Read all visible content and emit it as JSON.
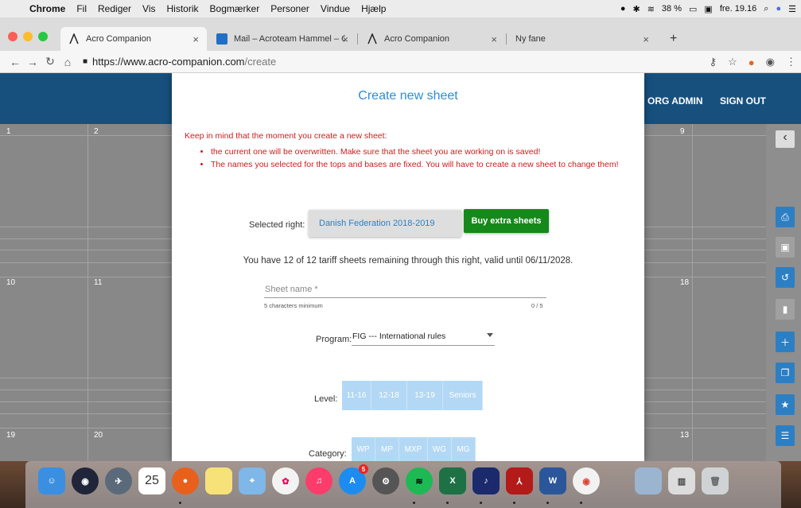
{
  "menubar": {
    "app": "Chrome",
    "items": [
      "Fil",
      "Rediger",
      "Vis",
      "Historik",
      "Bogmærker",
      "Personer",
      "Vindue",
      "Hjælp"
    ],
    "battery": "38 %",
    "clock": "fre. 19.16"
  },
  "tabs": [
    {
      "label": "Acro Companion"
    },
    {
      "label": "Mail – Acroteam Hammel – Out"
    },
    {
      "label": "Acro Companion"
    },
    {
      "label": "Ny fane"
    }
  ],
  "address": {
    "host": "https://www.acro-companion.com",
    "path": "/create"
  },
  "header": {
    "org_admin": "ORG ADMIN",
    "sign_out": "SIGN OUT"
  },
  "grid_numbers": [
    "1",
    "2",
    "9",
    "10",
    "11",
    "18",
    "19",
    "20",
    "13"
  ],
  "modal": {
    "title": "Create new sheet",
    "warning_intro": "Keep in mind that the moment you create a new sheet:",
    "warning_items": [
      "the current one will be overwritten. Make sure that the sheet you are working on is saved!",
      "The names you selected for the tops and bases are fixed. You will have to create a new sheet to change them!"
    ],
    "selected_right_label": "Selected right:",
    "selected_right_value": "Danish Federation 2018-2019",
    "buy_button": "Buy extra sheets",
    "remaining_text": "You have 12 of 12 tariff sheets remaining through this right, valid until 06/11/2028.",
    "sheet_name_label": "Sheet name *",
    "sheet_name_hint": "5 characters minimum",
    "sheet_name_count": "0 / 5",
    "program_label": "Program:",
    "program_value": "FIG --- International rules",
    "level_label": "Level:",
    "levels": [
      "11-16",
      "12-18",
      "13-19",
      "Seniors"
    ],
    "category_label": "Category:",
    "categories": [
      "WP",
      "MP",
      "MXP",
      "WG",
      "MG"
    ]
  },
  "dock": {
    "calendar_day": "25",
    "appstore_badge": "5"
  },
  "colors": {
    "header": "#17507d",
    "accent": "#2d8dd4",
    "warning": "#d11b1b",
    "buy": "#15891a",
    "toggle": "#b3d8f5"
  }
}
